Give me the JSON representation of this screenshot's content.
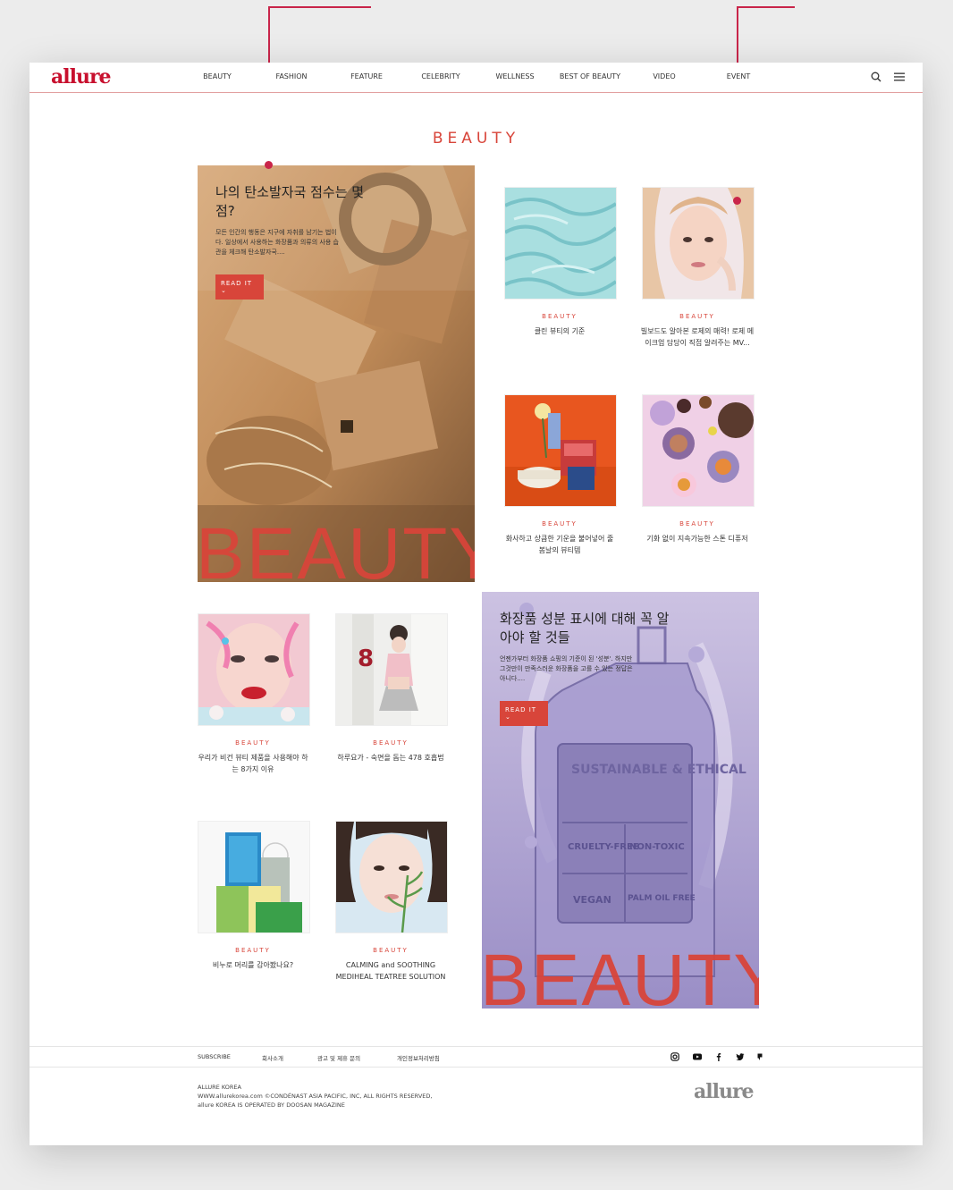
{
  "header": {
    "logo": "allure",
    "nav": [
      "BEAUTY",
      "FASHION",
      "FEATURE",
      "CELEBRITY",
      "WELLNESS",
      "BEST OF BEAUTY",
      "VIDEO",
      "EVENT"
    ]
  },
  "section_title": "BEAUTY",
  "feature_cards": [
    {
      "title": "나의 탄소발자국 점수는 몇 점?",
      "excerpt": "모든 인간의 행동은 지구에 자취를 남기는 법이다. 일상에서 사용하는 화장품과 의류의 사용 습관을 체크해 탄소발자국....",
      "button": "READ IT",
      "big_word": "BEAUTY"
    },
    {
      "title": "화장품 성분 표시에 대해 꼭 알아야 할 것들",
      "excerpt": "언젠가부터 화장품 쇼핑의 기준이 된 '성분'. 하지만 그것만이 만족스러운 화장품을 고를 수 있는 정답은 아니다....",
      "button": "READ IT",
      "big_word": "BEAUTY"
    }
  ],
  "articles": [
    {
      "category": "BEAUTY",
      "title": "클린 뷰티의 기준"
    },
    {
      "category": "BEAUTY",
      "title": "빌보드도 알아본 로제의 매력! 로제 메이크업 담당이 직접 알려주는 MV..."
    },
    {
      "category": "BEAUTY",
      "title": "화사하고 상큼한 기운을 불어넣어 줄 봄날의 뷰티템"
    },
    {
      "category": "BEAUTY",
      "title": "기화 없이 지속가능한 스톤 디퓨저"
    },
    {
      "category": "BEAUTY",
      "title": "우리가 비건 뷰티 제품을 사용해야 하는 8가지 이유"
    },
    {
      "category": "BEAUTY",
      "title": "하루요가 - 숙면을 돕는 478 호흡법"
    },
    {
      "category": "BEAUTY",
      "title": "비누로 머리를 감아봤나요?"
    },
    {
      "category": "BEAUTY",
      "title": "CALMING and SOOTHING MEDIHEAL TEATREE SOLUTION"
    }
  ],
  "thumb_text": {
    "yoga_number": "8"
  },
  "label_text": [
    "SUSTAINABLE & ETHICAL",
    "CRUELTY-FREE",
    "NON-TOXIC",
    "VEGAN",
    "PALM OIL FREE"
  ],
  "footer": {
    "links": [
      "SUBSCRIBE",
      "회사소개",
      "광고 및 제휴 문의",
      "개인정보처리방침"
    ],
    "social": [
      "instagram-icon",
      "youtube-icon",
      "facebook-icon",
      "twitter-icon",
      "blog-icon"
    ],
    "company": "ALLURE KOREA",
    "copyright": "WWW.allurekorea.com ©CONDÉNAST ASIA PACIFIC, INC, ALL RIGHTS RESERVED,",
    "operator": "allure KOREA IS OPERATED BY DOOSAN MAGAZINE",
    "logo": "allure"
  },
  "colors": {
    "accent": "#d8453a",
    "brand": "#c8102e",
    "callout": "#c9254a"
  }
}
